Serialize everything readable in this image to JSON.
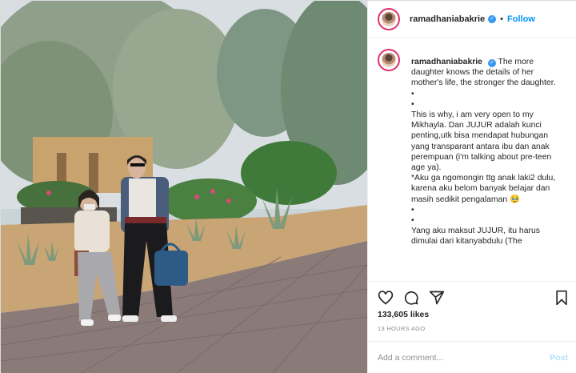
{
  "header": {
    "username": "ramadhaniabakrie",
    "separator": "•",
    "follow_label": "Follow"
  },
  "caption": {
    "username": "ramadhaniabakrie",
    "lines": [
      "The more daughter knows the details of her mother's life, the stronger the daughter.",
      "•",
      "•",
      "This is why, i am very open to my Mikhayla. Dan JUJUR adalah kunci penting,utk bisa mendapat hubungan yang transparant antara ibu dan anak perempuan (i'm talking about pre-teen age ya).",
      "*Aku ga ngomongin ttg anak laki2 dulu, karena aku belom banyak belajar dan masih sedikit pengalaman 🥹",
      "•",
      "•",
      "Yang aku maksut JUJUR, itu harus dimulai dari kitanyabdulu (The"
    ]
  },
  "actions": {
    "icons": [
      "heart-icon",
      "comment-icon",
      "share-icon",
      "bookmark-icon"
    ]
  },
  "likes_text": "133,605 likes",
  "timestamp": "13 HOURS AGO",
  "comment_box": {
    "placeholder": "Add a comment...",
    "post_label": "Post"
  },
  "colors": {
    "follow": "#0095f6",
    "verified": "#3897f0",
    "post_disabled": "#b2dffc"
  }
}
